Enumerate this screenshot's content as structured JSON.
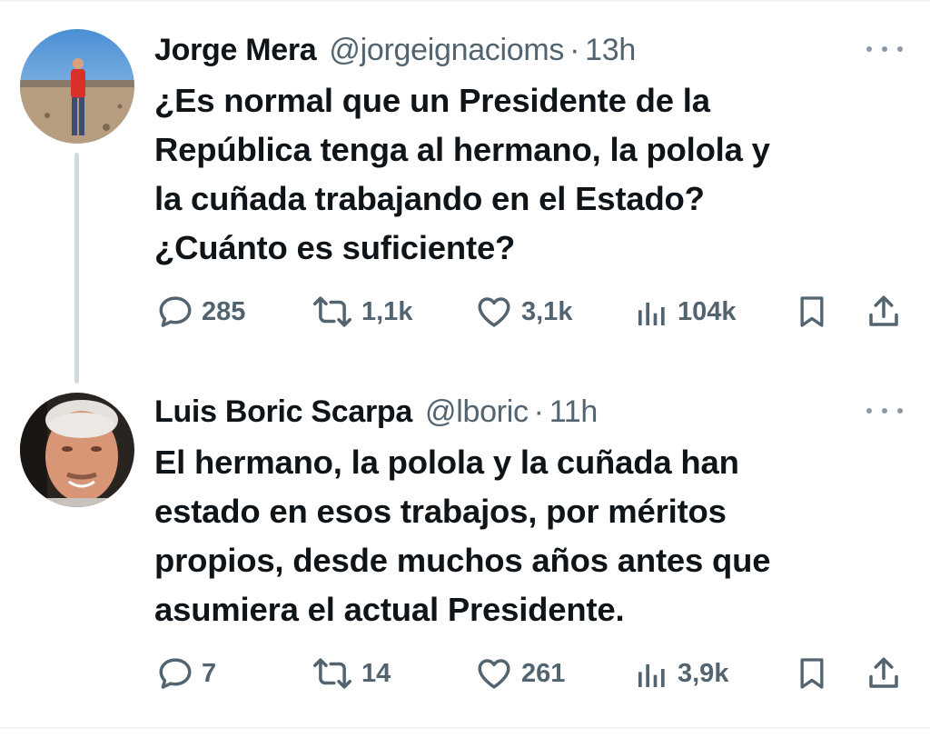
{
  "tweets": [
    {
      "name": "Jorge Mera",
      "handle": "@jorgeignacioms",
      "separator": "·",
      "time": "13h",
      "text_lines": [
        "¿Es normal que un Presidente de la",
        "República tenga al hermano, la polola y",
        "la cuñada trabajando en el Estado?",
        "¿Cuánto es suficiente?"
      ],
      "replies": "285",
      "reposts": "1,1k",
      "likes": "3,1k",
      "views": "104k"
    },
    {
      "name": "Luis Boric Scarpa",
      "handle": "@lboric",
      "separator": "·",
      "time": "11h",
      "text_lines": [
        "El hermano, la polola y la cuñada han",
        "estado en esos trabajos, por méritos",
        "propios, desde muchos años antes que",
        "asumiera el actual Presidente."
      ],
      "replies": "7",
      "reposts": "14",
      "likes": "261",
      "views": "3,9k"
    }
  ],
  "icons": {
    "reply": "speech-bubble-icon",
    "repost": "repost-arrows-icon",
    "like": "heart-icon",
    "views": "bar-chart-icon",
    "bookmark": "bookmark-icon",
    "share": "share-upload-icon",
    "more": "more-dots-icon"
  },
  "colors": {
    "text": "#0f1419",
    "secondary": "#536471",
    "divider": "#eff3f4",
    "thread_line": "#cfd9de"
  }
}
